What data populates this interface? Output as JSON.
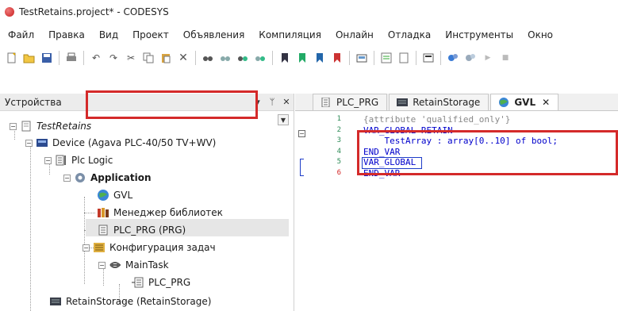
{
  "window": {
    "title": "TestRetains.project* - CODESYS"
  },
  "menu": [
    "Файл",
    "Правка",
    "Вид",
    "Проект",
    "Объявления",
    "Компиляция",
    "Онлайн",
    "Отладка",
    "Инструменты",
    "Окно"
  ],
  "toolbar": {
    "buttons": [
      "new-icon",
      "open-icon",
      "save-icon",
      "print-icon",
      "undo-icon",
      "redo-icon",
      "cut-icon",
      "copy-icon",
      "paste-icon",
      "delete-icon",
      "find-icon",
      "find-next-icon",
      "replace-icon",
      "replace-all-icon",
      "bookmark-icon",
      "prev-bookmark-icon",
      "next-bookmark-icon",
      "clear-bookmarks-icon",
      "device-icon",
      "add-object-icon",
      "object-icon",
      "login-icon",
      "build-icon",
      "rebuild-icon",
      "run-icon",
      "stop-icon"
    ]
  },
  "devices_panel": {
    "title": "Устройства",
    "pin": "▾",
    "dock": "ᛘ",
    "close": "✕",
    "tree": {
      "root": "TestRetains",
      "device": "Device (Agava PLC-40/50 TV+WV)",
      "plc_logic": "Plc Logic",
      "application": "Application",
      "gvl": "GVL",
      "library_manager": "Менеджер библиотек",
      "plc_prg": "PLC_PRG (PRG)",
      "task_config": "Конфигурация задач",
      "main_task": "MainTask",
      "task_plc_prg": "PLC_PRG",
      "retain_storage": "RetainStorage (RetainStorage)"
    }
  },
  "editor": {
    "tabs": [
      {
        "label": "PLC_PRG"
      },
      {
        "label": "RetainStorage"
      },
      {
        "label": "GVL",
        "close": "✕"
      }
    ],
    "lines": [
      {
        "num": "1",
        "text": "{attribute 'qualified_only'}"
      },
      {
        "num": "2",
        "text": "VAR_GLOBAL RETAIN"
      },
      {
        "num": "3",
        "text": "    TestArray : array[0..10] of bool;"
      },
      {
        "num": "4",
        "text": "END_VAR"
      },
      {
        "num": "5",
        "text": "VAR_GLOBAL"
      },
      {
        "num": "6",
        "text": "END_VAR"
      }
    ]
  },
  "colors": {
    "annotation": "#d42a2a",
    "keyword": "#0000cc",
    "line_number": "#2e8b57",
    "selection": "#e6e6e6"
  }
}
